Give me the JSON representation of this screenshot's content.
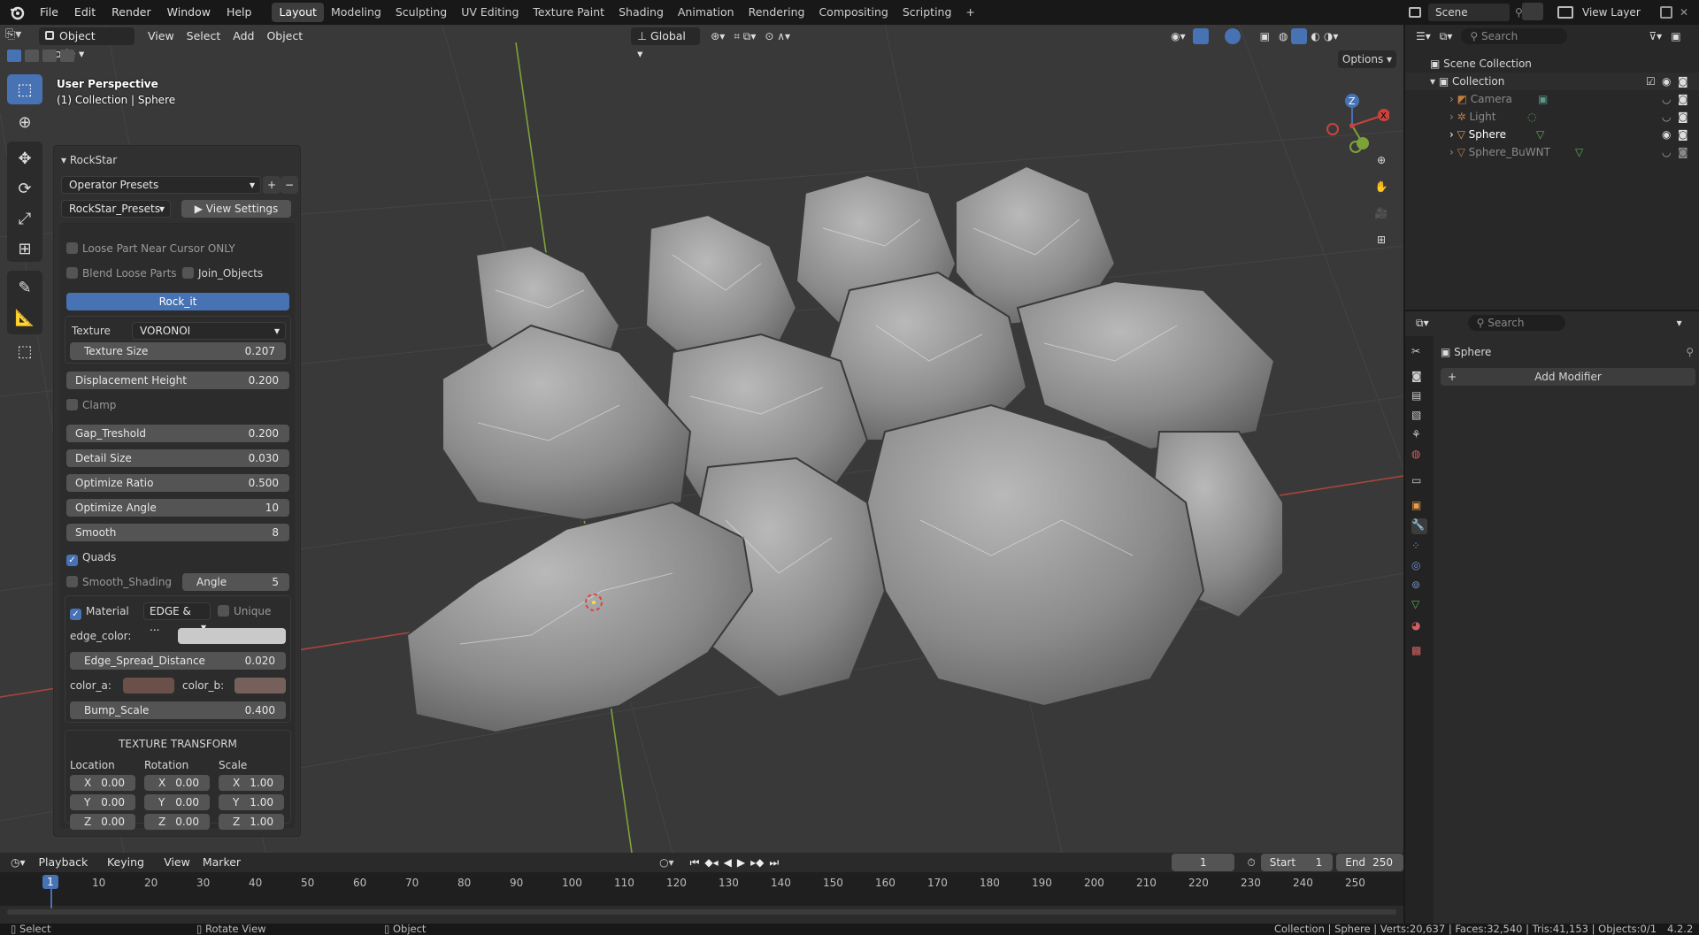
{
  "menubar": {
    "file": "File",
    "edit": "Edit",
    "render": "Render",
    "window": "Window",
    "help": "Help"
  },
  "workspaces": [
    "Layout",
    "Modeling",
    "Sculpting",
    "UV Editing",
    "Texture Paint",
    "Shading",
    "Animation",
    "Rendering",
    "Compositing",
    "Scripting",
    "+"
  ],
  "scene_selector": "Scene",
  "view_layer": "View Layer",
  "viewport": {
    "mode": "Object Mode",
    "view": "View",
    "select": "Select",
    "add": "Add",
    "object": "Object",
    "orientation": "Global",
    "options": "Options",
    "persp_line1": "User Perspective",
    "persp_line2": "(1) Collection | Sphere",
    "gizmo": {
      "x": "X",
      "y": "Y",
      "z": "Z"
    }
  },
  "panel": {
    "title": "RockStar",
    "operator_presets": "Operator Presets",
    "plus": "+",
    "minus": "−",
    "presets_menu": "RockStar_Presets",
    "view_settings": "View Settings",
    "loose_part": "Loose Part Near Cursor ONLY",
    "blend_loose": "Blend Loose Parts",
    "join_objects": "Join_Objects",
    "rock_it": "Rock_it",
    "texture_label": "Texture",
    "texture_value": "VORONOI",
    "texture_size": "Texture Size",
    "texture_size_val": "0.207",
    "disp_height": "Displacement Height",
    "disp_height_val": "0.200",
    "clamp": "Clamp",
    "gap": "Gap_Treshold",
    "gap_val": "0.200",
    "detail": "Detail Size",
    "detail_val": "0.030",
    "opt_ratio": "Optimize Ratio",
    "opt_ratio_val": "0.500",
    "opt_angle": "Optimize Angle",
    "opt_angle_val": "10",
    "smooth": "Smooth",
    "smooth_val": "8",
    "quads": "Quads",
    "smooth_shading": "Smooth_Shading",
    "angle": "Angle",
    "angle_val": "5",
    "material": "Material",
    "material_mode": "EDGE & ...",
    "unique": "Unique",
    "edge_color": "edge_color:",
    "edge_spread": "Edge_Spread_Distance",
    "edge_spread_val": "0.020",
    "color_a": "color_a:",
    "color_b": "color_b:",
    "bump": "Bump_Scale",
    "bump_val": "0.400",
    "tt_title": "TEXTURE TRANSFORM",
    "location": "Location",
    "rotation": "Rotation",
    "scale": "Scale",
    "loc": [
      "0.00",
      "0.00",
      "0.00"
    ],
    "rot": [
      "0.00",
      "0.00",
      "0.00"
    ],
    "scl": [
      "1.00",
      "1.00",
      "1.00"
    ],
    "axes": [
      "X",
      "Y",
      "Z"
    ],
    "colors": {
      "edge": "#c9c9c9",
      "a": "#6a5048",
      "b": "#76605c"
    }
  },
  "timeline": {
    "playback": "Playback",
    "keying": "Keying",
    "view": "View",
    "marker": "Marker",
    "current": "1",
    "start_label": "Start",
    "start": "1",
    "end_label": "End",
    "end": "250",
    "ticks": [
      "10",
      "20",
      "30",
      "40",
      "50",
      "60",
      "70",
      "80",
      "90",
      "100",
      "110",
      "120",
      "130",
      "140",
      "150",
      "160",
      "170",
      "180",
      "190",
      "200",
      "210",
      "220",
      "230",
      "240",
      "250"
    ],
    "frame": "1"
  },
  "status": {
    "select": "Select",
    "rotate": "Rotate View",
    "object": "Object",
    "stats": "Collection | Sphere | Verts:20,637 | Faces:32,540 | Tris:41,153 | Objects:0/1",
    "version": "4.2.2"
  },
  "outliner": {
    "search": "Search",
    "root": "Scene Collection",
    "collection": "Collection",
    "items": [
      "Camera",
      "Light",
      "Sphere",
      "Sphere_BuWNT"
    ]
  },
  "properties": {
    "search": "Search",
    "object": "Sphere",
    "add_modifier": "Add Modifier"
  },
  "accent": "#4772b3"
}
